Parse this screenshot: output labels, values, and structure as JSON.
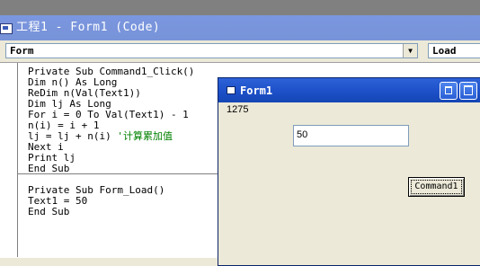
{
  "code_window": {
    "title": "工程1 - Form1 (Code)",
    "object_combo_value": "Form",
    "procedure_combo_value": "Load"
  },
  "code": {
    "proc1": [
      "Private Sub Command1_Click()",
      "Dim n() As Long",
      "ReDim n(Val(Text1))",
      "Dim lj As Long",
      "For i = 0 To Val(Text1) - 1",
      "n(i) = i + 1"
    ],
    "line7_code": "lj = lj + n(i) ",
    "line7_comment": "'计算累加值",
    "proc1_tail": [
      "Next i",
      "Print lj",
      "End Sub"
    ],
    "proc2": [
      "Private Sub Form_Load()",
      "Text1 = 50",
      "End Sub"
    ]
  },
  "form_window": {
    "title": "Form1",
    "printed_output": "1275",
    "text1_value": "50",
    "command1_label": "Command1"
  },
  "colors": {
    "comment": "#008000",
    "form_titlebar": "#1c4fc7",
    "code_titlebar": "#7893d8"
  }
}
